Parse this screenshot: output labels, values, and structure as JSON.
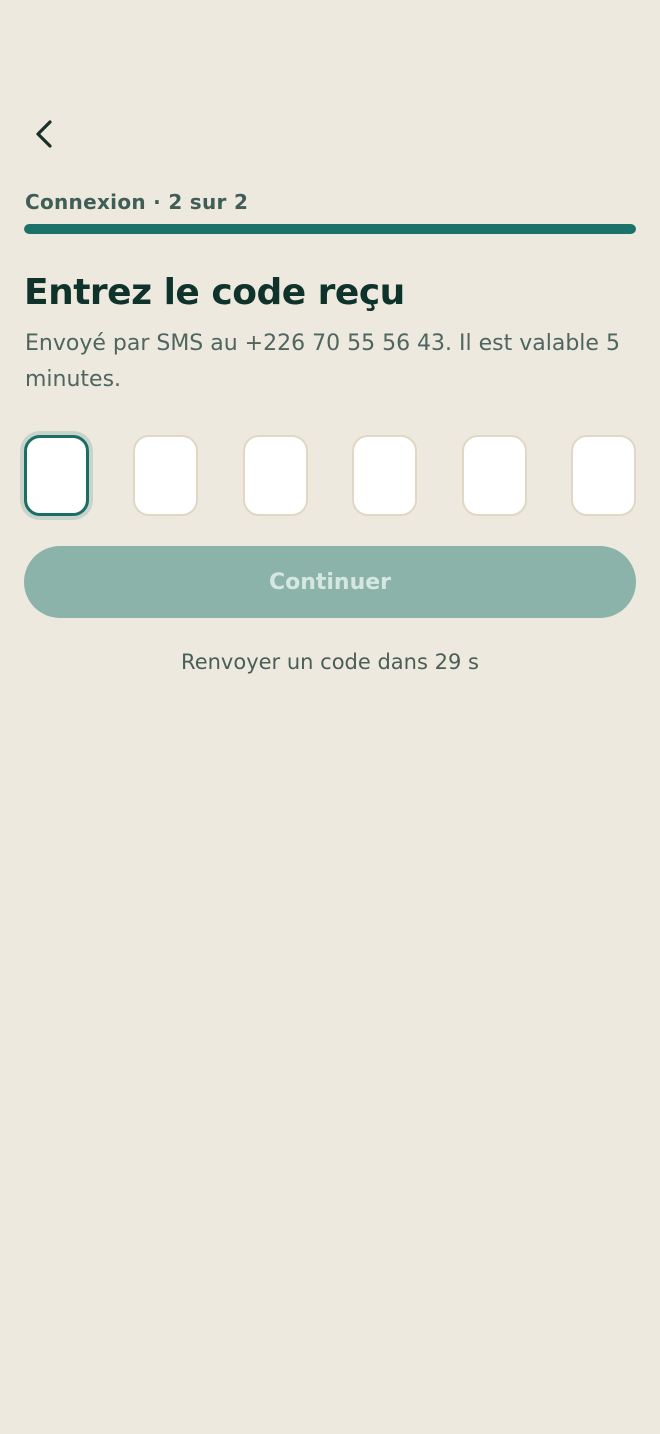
{
  "header": {
    "back_icon": "chevron-left-icon",
    "step_label": "Connexion · 2 sur 2",
    "progress_fraction": 1.0
  },
  "main": {
    "title": "Entrez le code reçu",
    "subtitle": "Envoyé par SMS au +226 70 55 56 43. Il est valable 5 minutes.",
    "otp": {
      "digits": [
        "",
        "",
        "",
        "",
        "",
        ""
      ],
      "active_index": 0
    },
    "continue_label": "Continuer",
    "resend_text": "Renvoyer un code dans 29 s"
  },
  "colors": {
    "background": "#EEE9DE",
    "accent": "#1A7268",
    "button_disabled": "#8BB3A9",
    "title": "#0F332B"
  }
}
